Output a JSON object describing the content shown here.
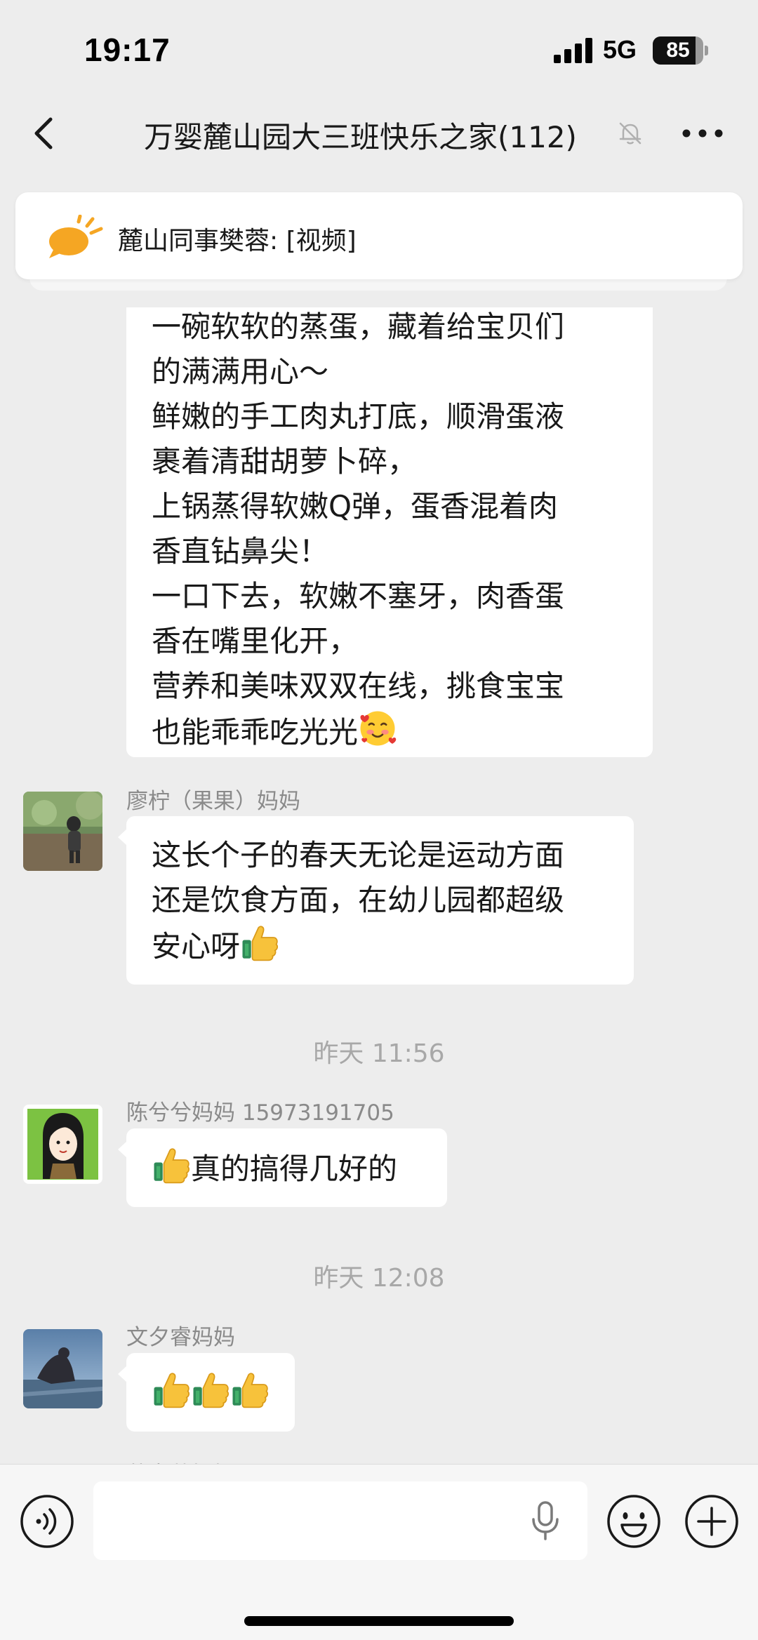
{
  "status_bar": {
    "time": "19:17",
    "network": "5G",
    "battery_level": "85",
    "battery_fraction": 0.85
  },
  "nav": {
    "title": "万婴麓山园大三班快乐之家(112)"
  },
  "pinned_notice": {
    "text": "麓山同事樊蓉: [视频]"
  },
  "messages": {
    "m1": {
      "lines": [
        "一碗软软的蒸蛋，藏着给宝贝们",
        "的满满用心～",
        "鲜嫩的手工肉丸打底，顺滑蛋液",
        "裹着清甜胡萝卜碎，",
        "上锅蒸得软嫩Q弹，蛋香混着肉",
        "香直钻鼻尖！",
        "一口下去，软嫩不塞牙，肉香蛋",
        "香在嘴里化开，",
        "营养和美味双双在线，挑食宝宝",
        "也能乖乖吃光光"
      ],
      "emoji": "smiling-face-with-hearts"
    },
    "m2": {
      "sender": "廖柠（果果）妈妈",
      "lines": [
        "这长个子的春天无论是运动方面",
        "还是饮食方面，在幼儿园都超级",
        "安心呀"
      ],
      "emoji": "thumbs-up"
    },
    "ts1": "昨天 11:56",
    "m3": {
      "sender": "陈兮兮妈妈 15973191705",
      "text": "真的搞得几好的",
      "emoji": "thumbs-up"
    },
    "ts2": "昨天 12:08",
    "m4": {
      "sender": "文夕睿妈妈",
      "emoji": "thumbs-up x3"
    },
    "m5": {
      "sender_partial": "莫奕萌妈妈"
    }
  },
  "input_bar": {
    "placeholder": ""
  },
  "icons": {
    "back": "chevron-left-icon",
    "mute": "bell-slash-icon",
    "more": "ellipsis-icon",
    "notice": "megaphone-icon",
    "voice": "voice-wave-icon",
    "mic": "microphone-icon",
    "emoji": "smiley-icon",
    "plus": "plus-circle-icon"
  },
  "colors": {
    "background": "#ededed",
    "bubble": "#ffffff",
    "notice_icon": "#f5a623",
    "meta_text": "#a8a8a8"
  }
}
